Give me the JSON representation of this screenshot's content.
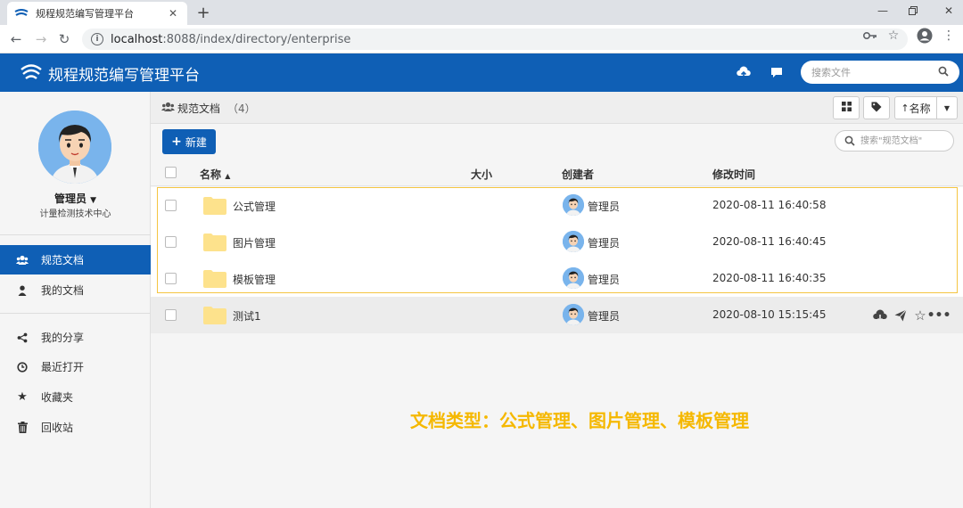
{
  "browser": {
    "tab_title": "规程规范编写管理平台",
    "url_host": "localhost",
    "url_path": ":8088/index/directory/enterprise"
  },
  "app": {
    "title": "规程规范编写管理平台",
    "search_placeholder": "搜索文件"
  },
  "user": {
    "name": "管理员",
    "department": "计量检测技术中心"
  },
  "sidebar": {
    "items": [
      {
        "label": "规范文档",
        "icon": "users-icon",
        "active": true
      },
      {
        "label": "我的文档",
        "icon": "user-icon",
        "active": false
      },
      {
        "label": "我的分享",
        "icon": "share-icon",
        "active": false
      },
      {
        "label": "最近打开",
        "icon": "clock-icon",
        "active": false
      },
      {
        "label": "收藏夹",
        "icon": "star-icon",
        "active": false
      },
      {
        "label": "回收站",
        "icon": "trash-icon",
        "active": false
      }
    ]
  },
  "main": {
    "breadcrumb": "规范文档",
    "count": "（4）",
    "sort_label": "名称",
    "new_label": "新建",
    "search_placeholder": "搜索\"规范文档\"",
    "columns": {
      "name": "名称",
      "size": "大小",
      "creator": "创建者",
      "modified": "修改时间"
    },
    "rows": [
      {
        "name": "公式管理",
        "size": "",
        "creator": "管理员",
        "modified": "2020-08-11 16:40:58"
      },
      {
        "name": "图片管理",
        "size": "",
        "creator": "管理员",
        "modified": "2020-08-11 16:40:45"
      },
      {
        "name": "模板管理",
        "size": "",
        "creator": "管理员",
        "modified": "2020-08-11 16:40:35"
      },
      {
        "name": "测试1",
        "size": "",
        "creator": "管理员",
        "modified": "2020-08-10 15:15:45"
      }
    ]
  },
  "annotation": "文档类型：公式管理、图片管理、模板管理",
  "colors": {
    "brand": "#0f5fb5",
    "annotation": "#f5b800",
    "folder": "#fde28c",
    "selection_border": "#f5c542"
  }
}
